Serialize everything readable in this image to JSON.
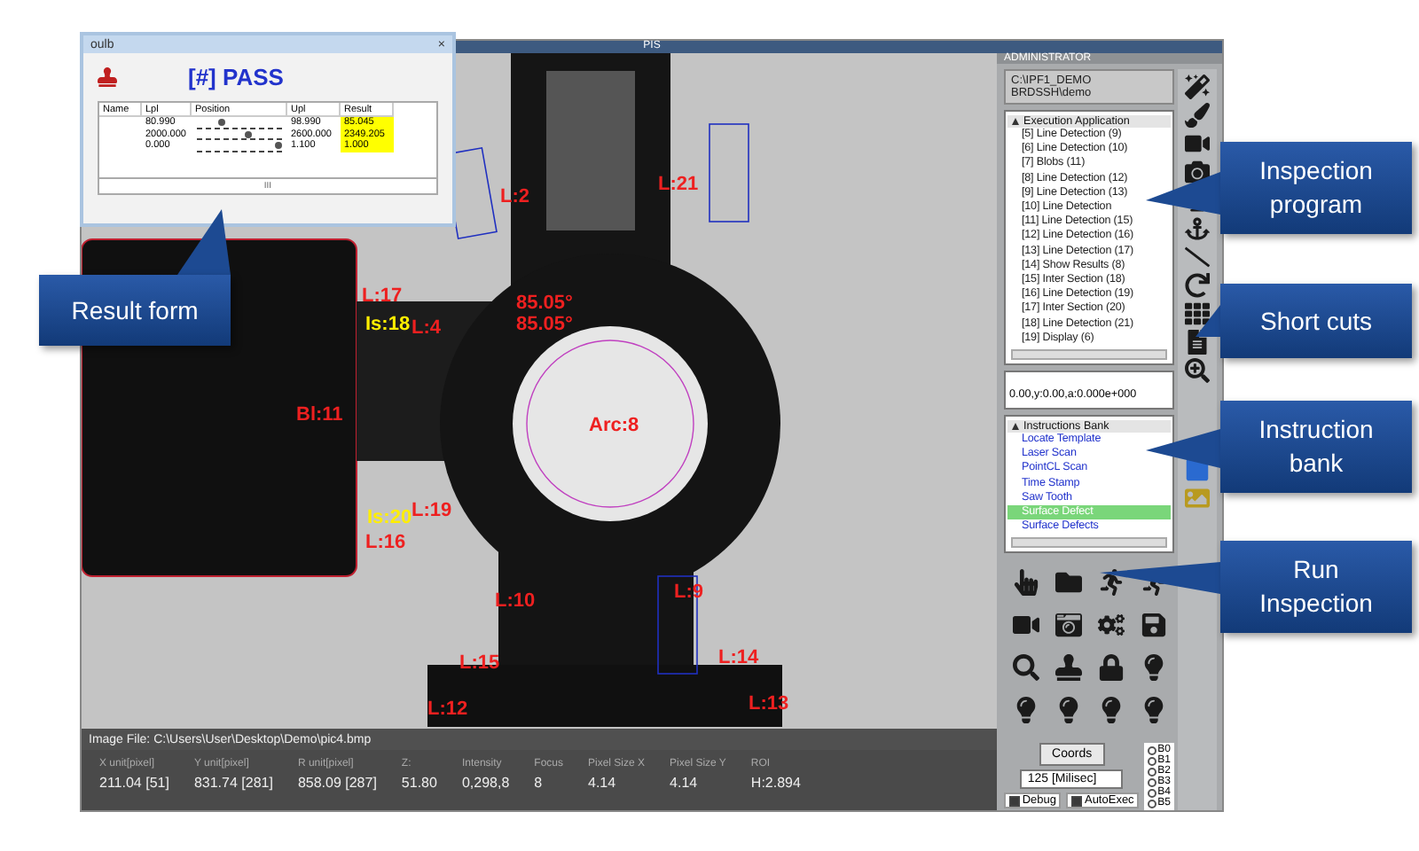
{
  "window": {
    "title": "PIS"
  },
  "result_form": {
    "title": "oulb",
    "close": "×",
    "verdict": "[#] PASS",
    "columns": [
      "Name",
      "Lpl",
      "Position",
      "Upl",
      "Result"
    ],
    "rows": [
      {
        "name": "",
        "lpl": "80.990",
        "level": 0.3,
        "upl": "98.990",
        "result": "85.045"
      },
      {
        "name": "",
        "lpl": "2000.000",
        "level": 0.6,
        "upl": "2600.000",
        "result": "2349.205"
      },
      {
        "name": "",
        "lpl": "0.000",
        "level": 0.95,
        "upl": "1.100",
        "result": "1.000"
      }
    ],
    "scroll_grip": "III"
  },
  "viewer": {
    "labels": [
      {
        "text": "L:2",
        "kind": "measure"
      },
      {
        "text": "L:21",
        "kind": "measure"
      },
      {
        "text": "L:17",
        "kind": "measure"
      },
      {
        "text": "Is:18",
        "kind": "intersection"
      },
      {
        "text": "L:4",
        "kind": "measure"
      },
      {
        "text": "85.05°",
        "kind": "measure"
      },
      {
        "text": "85.05°",
        "kind": "measure"
      },
      {
        "text": "Bl:11",
        "kind": "measure"
      },
      {
        "text": "Arc:8",
        "kind": "measure"
      },
      {
        "text": "L:19",
        "kind": "measure"
      },
      {
        "text": "Is:20",
        "kind": "intersection"
      },
      {
        "text": "L:16",
        "kind": "measure"
      },
      {
        "text": "L:10",
        "kind": "measure"
      },
      {
        "text": "L:9",
        "kind": "measure"
      },
      {
        "text": "L:15",
        "kind": "measure"
      },
      {
        "text": "L:14",
        "kind": "measure"
      },
      {
        "text": "L:12",
        "kind": "measure"
      },
      {
        "text": "L:13",
        "kind": "measure"
      }
    ],
    "image_file": "Image File: C:\\Users\\User\\Desktop\\Demo\\pic4.bmp",
    "status_fields": [
      {
        "label": "X unit[pixel]",
        "value": "211.04 [51]"
      },
      {
        "label": "Y unit[pixel]",
        "value": "831.74 [281]"
      },
      {
        "label": "R unit[pixel]",
        "value": "858.09 [287]"
      },
      {
        "label": "Z:",
        "value": "51.80"
      },
      {
        "label": "Intensity",
        "value": "0,298,8"
      },
      {
        "label": "Focus",
        "value": "8"
      },
      {
        "label": "Pixel Size X",
        "value": "4.14"
      },
      {
        "label": "Pixel Size Y",
        "value": "4.14"
      },
      {
        "label": "ROI",
        "value": "H:2.894"
      }
    ]
  },
  "panel": {
    "header": "ADMINISTRATOR",
    "path": [
      "C:\\IPF1_DEMO",
      "BRDSSH\\demo"
    ],
    "program": {
      "title": "Execution Application",
      "expanded": true,
      "children": [
        "[5] Line Detection (9)",
        "[6] Line Detection (10)",
        "[7] Blobs (11)",
        "[8] Line Detection (12)",
        "[9] Line Detection (13)",
        "[10] Line Detection",
        "[11] Line Detection (15)",
        "[12] Line Detection (16)",
        "[13] Line Detection (17)",
        "[14] Show Results (8)",
        "[15] Inter Section (18)",
        "[16] Line Detection (19)",
        "[17] Inter Section (20)",
        "[18] Line Detection (21)",
        "[19] Display (6)"
      ]
    },
    "coordinates": "0.00,y:0.00,a:0.000e+000",
    "instructions": {
      "title": "Instructions Bank",
      "expanded": true,
      "items": [
        {
          "label": "Locate Template",
          "selected": false
        },
        {
          "label": "Laser Scan",
          "selected": false
        },
        {
          "label": "PointCL Scan",
          "selected": false
        },
        {
          "label": "Time Stamp",
          "selected": false
        },
        {
          "label": "Saw Tooth",
          "selected": false
        },
        {
          "label": "Surface Defect",
          "selected": true
        },
        {
          "label": "Surface Defects",
          "selected": false
        }
      ]
    },
    "coords_button": "Coords",
    "interval": "125 [Milisec]",
    "checks": [
      {
        "label": "Debug",
        "checked": true
      },
      {
        "label": "AutoExec",
        "checked": true
      }
    ],
    "radios": [
      {
        "label": "B0",
        "selected": false
      },
      {
        "label": "B1",
        "selected": false
      },
      {
        "label": "B2",
        "selected": false
      },
      {
        "label": "B3",
        "selected": false
      },
      {
        "label": "B4",
        "selected": false
      },
      {
        "label": "B5",
        "selected": false
      }
    ]
  },
  "callouts": [
    {
      "text": "Result form"
    },
    {
      "text": "Inspection program"
    },
    {
      "text": "Short cuts"
    },
    {
      "text": "Instruction bank"
    },
    {
      "text": "Run Inspection"
    }
  ]
}
